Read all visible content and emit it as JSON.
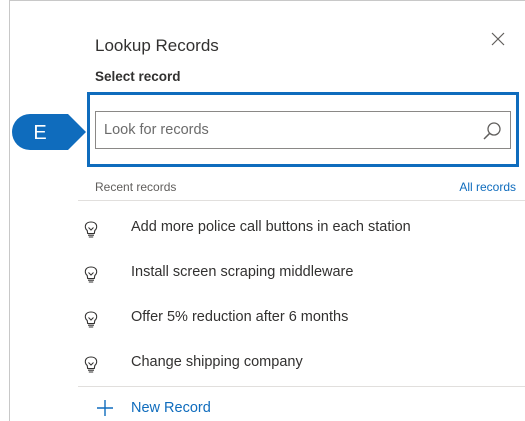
{
  "dialog": {
    "title": "Lookup Records",
    "subtitle": "Select record",
    "close_icon": "close-icon"
  },
  "callout": {
    "label": "E",
    "color": "#0f6cbd"
  },
  "search": {
    "placeholder": "Look for records",
    "value": "",
    "icon": "search-icon"
  },
  "recent": {
    "label": "Recent records",
    "all_link": "All records",
    "items": [
      {
        "label": "Add more police call buttons in each station",
        "icon": "lightbulb-icon"
      },
      {
        "label": "Install screen scraping middleware",
        "icon": "lightbulb-icon"
      },
      {
        "label": "Offer 5% reduction after 6 months",
        "icon": "lightbulb-icon"
      },
      {
        "label": "Change shipping company",
        "icon": "lightbulb-icon"
      }
    ]
  },
  "footer": {
    "new_record_label": "New Record",
    "new_record_icon": "plus-icon"
  },
  "colors": {
    "accent": "#0f6cbd",
    "text": "#323130",
    "muted": "#605e5c",
    "divider": "#e1dfdd"
  }
}
